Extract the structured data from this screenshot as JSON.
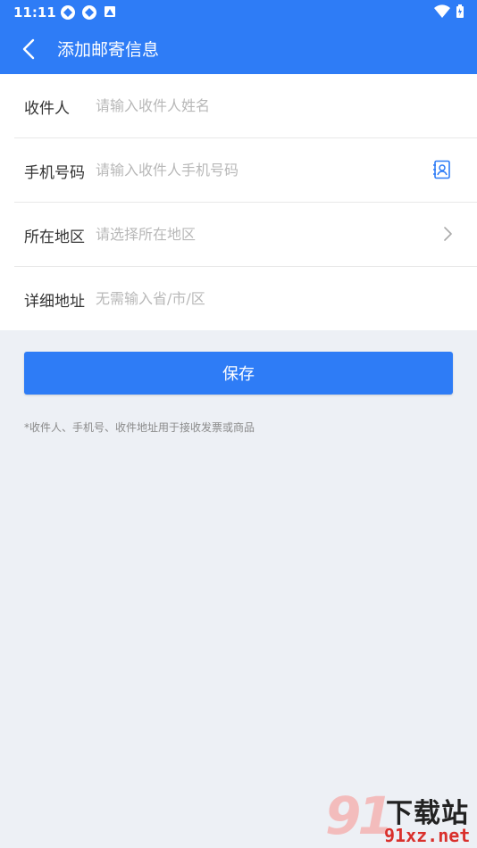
{
  "status_bar": {
    "time": "11:11"
  },
  "header": {
    "title": "添加邮寄信息"
  },
  "form": {
    "rows": [
      {
        "label": "收件人",
        "placeholder": "请输入收件人姓名"
      },
      {
        "label": "手机号码",
        "placeholder": "请输入收件人手机号码"
      },
      {
        "label": "所在地区",
        "placeholder": "请选择所在地区"
      },
      {
        "label": "详细地址",
        "placeholder": "无需输入省/市/区"
      }
    ]
  },
  "save_label": "保存",
  "note": "*收件人、手机号、收件地址用于接收发票或商品",
  "watermark": {
    "logo_number": "91",
    "site_name": "下载站",
    "url": "91xz.net"
  },
  "colors": {
    "primary": "#2e7cf6",
    "background": "#edf0f5"
  }
}
